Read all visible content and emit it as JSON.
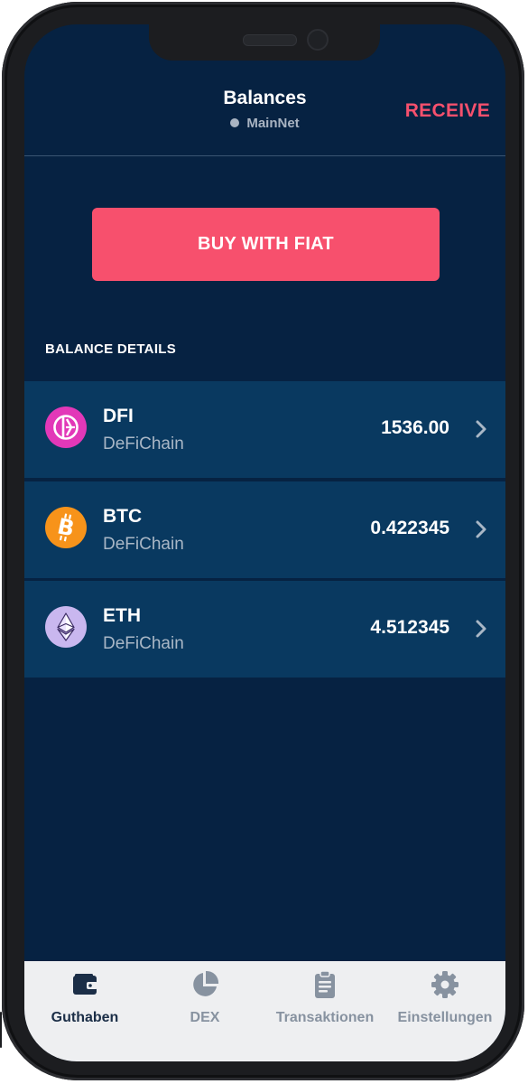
{
  "header": {
    "title": "Balances",
    "network": "MainNet",
    "receive_label": "RECEIVE"
  },
  "buy_button_label": "BUY WITH FIAT",
  "section_title": "BALANCE DETAILS",
  "tokens": [
    {
      "symbol": "DFI",
      "network": "DeFiChain",
      "amount": "1536.00",
      "icon": "defichain-icon",
      "icon_color": "#e238b8"
    },
    {
      "symbol": "BTC",
      "network": "DeFiChain",
      "amount": "0.422345",
      "icon": "bitcoin-icon",
      "icon_color": "#f7931a"
    },
    {
      "symbol": "ETH",
      "network": "DeFiChain",
      "amount": "4.512345",
      "icon": "ethereum-icon",
      "icon_color": "#c9b7ef"
    }
  ],
  "tabs": [
    {
      "label": "Guthaben",
      "icon": "wallet-icon",
      "active": true
    },
    {
      "label": "DEX",
      "icon": "pie-chart-icon",
      "active": false
    },
    {
      "label": "Transaktionen",
      "icon": "clipboard-icon",
      "active": false
    },
    {
      "label": "Einstellungen",
      "icon": "gear-icon",
      "active": false
    }
  ],
  "colors": {
    "background": "#062242",
    "row": "#093960",
    "accent": "#f7506d",
    "tabbar": "#eeeff1"
  }
}
